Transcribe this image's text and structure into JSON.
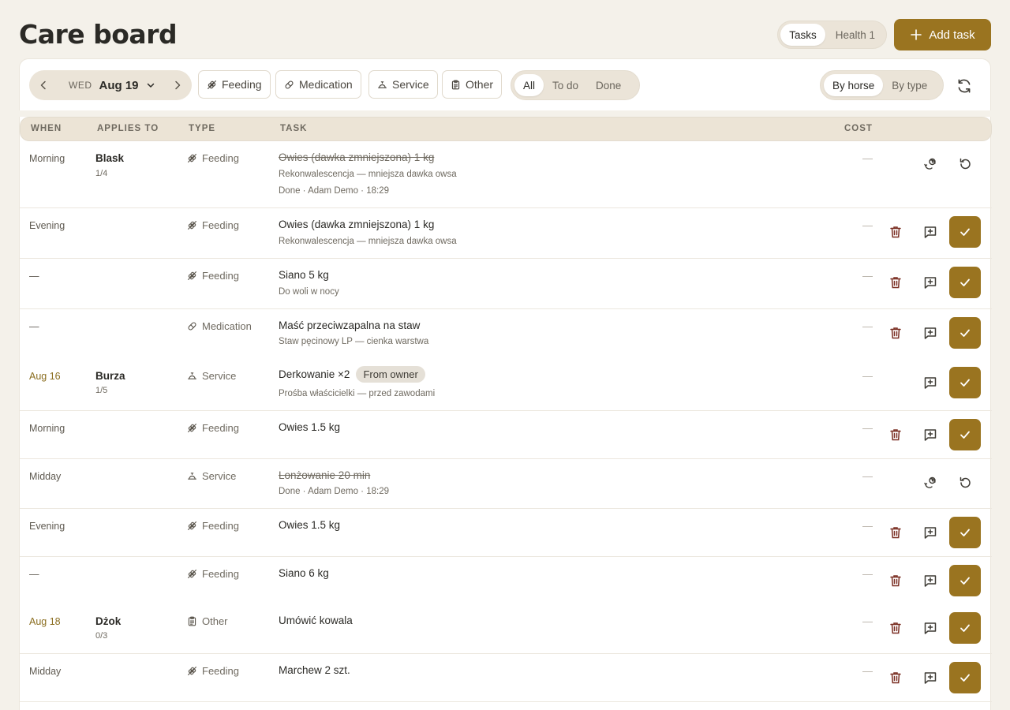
{
  "header": {
    "title": "Care board",
    "tabs": [
      {
        "label": "Tasks",
        "active": true
      },
      {
        "label": "Health",
        "count": "1"
      }
    ],
    "health_label": "Health 1",
    "add_task_label": "Add task"
  },
  "toolbar": {
    "date": {
      "dow": "WED",
      "day": "Aug 19"
    },
    "filters": [
      "Feeding",
      "Medication",
      "Service",
      "Other"
    ],
    "status": [
      "All",
      "To do",
      "Done"
    ],
    "status_active": "All",
    "group": [
      "By horse",
      "By type"
    ],
    "group_active": "By horse"
  },
  "table": {
    "columns": [
      "WHEN",
      "APPLIES TO",
      "TYPE",
      "TASK",
      "COST"
    ],
    "rows": [
      {
        "when": "Morning",
        "horse": "Blask",
        "horse_count": "1/4",
        "type": "Feeding",
        "task": "Owies (dawka zmniejszona) 1 kg",
        "sub": "Rekonwalescencja — mniejsza dawka owsa",
        "sub2": "Done · Adam Demo · 18:29",
        "done": true,
        "cost": "—"
      },
      {
        "when": "Evening",
        "type": "Feeding",
        "task": "Owies (dawka zmniejszona) 1 kg",
        "sub": "Rekonwalescencja — mniejsza dawka owsa",
        "done": false,
        "cost": "—"
      },
      {
        "when": "—",
        "type": "Feeding",
        "task": "Siano 5 kg",
        "sub": "Do woli w nocy",
        "done": false,
        "cost": "—"
      },
      {
        "when": "—",
        "type": "Medication",
        "task": "Maść przeciwzapalna na staw",
        "sub": "Staw pęcinowy LP — cienka warstwa",
        "done": false,
        "cost": "—"
      },
      {
        "when": "Aug 16",
        "horse": "Burza",
        "horse_count": "1/5",
        "type": "Service",
        "task": "Derkowanie ×2",
        "badge": "From owner",
        "sub": "Prośba właścicielki — przed zawodami",
        "done": false,
        "cost": "—"
      },
      {
        "when": "Morning",
        "type": "Feeding",
        "task": "Owies 1.5 kg",
        "done": false,
        "cost": "—"
      },
      {
        "when": "Midday",
        "type": "Service",
        "task": "Lonżowanie 20 min",
        "sub": "Done · Adam Demo · 18:29",
        "done": true,
        "cost": "—"
      },
      {
        "when": "Evening",
        "type": "Feeding",
        "task": "Owies 1.5 kg",
        "done": false,
        "cost": "—"
      },
      {
        "when": "—",
        "type": "Feeding",
        "task": "Siano 6 kg",
        "done": false,
        "cost": "—"
      },
      {
        "when": "Aug 18",
        "horse": "Dżok",
        "horse_count": "0/3",
        "type": "Other",
        "task": "Umówić kowala",
        "done": false,
        "cost": "—"
      },
      {
        "when": "Midday",
        "type": "Feeding",
        "task": "Marchew 2 szt.",
        "done": false,
        "cost": "—"
      }
    ]
  },
  "colors": {
    "accent": "#9a7420",
    "background": "#f4f1ea",
    "danger": "#7a2e22"
  }
}
